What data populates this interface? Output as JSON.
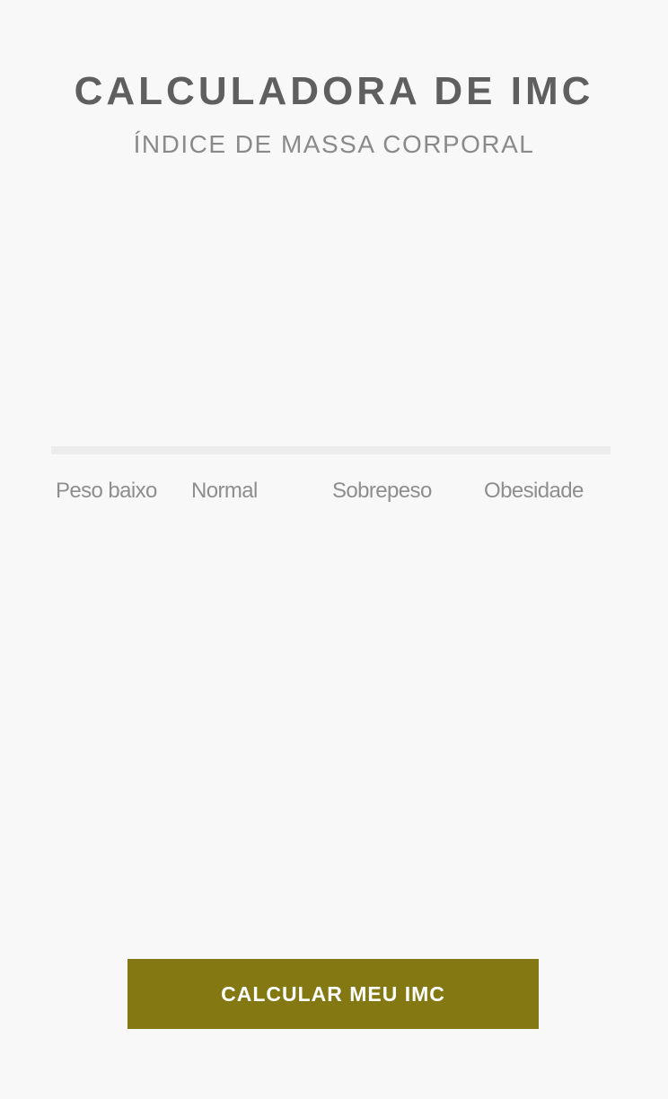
{
  "header": {
    "title": "CALCULADORA DE IMC",
    "subtitle": "ÍNDICE DE MASSA CORPORAL"
  },
  "scale": {
    "track_color": "#ececec",
    "fill_fraction": 0,
    "categories": [
      "Peso baixo",
      "Normal",
      "Sobrepeso",
      "Obesidade"
    ]
  },
  "actions": {
    "calculate_label": "CALCULAR MEU IMC",
    "button_color": "#847813"
  }
}
